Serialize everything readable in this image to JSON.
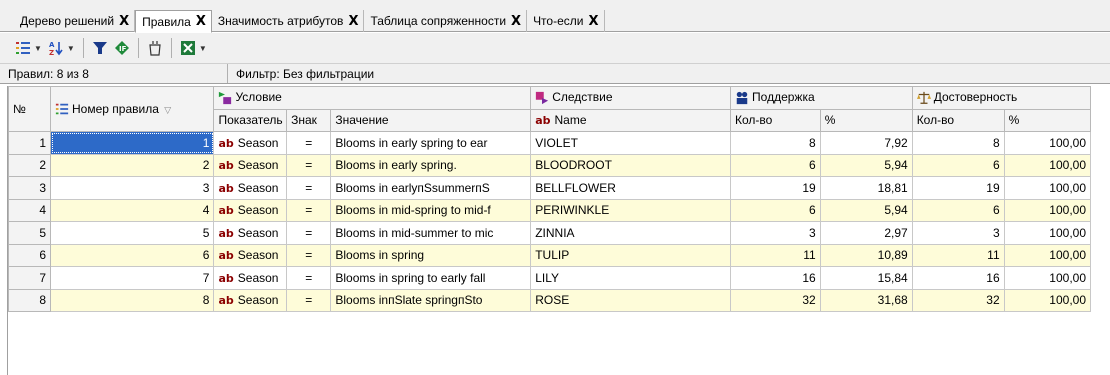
{
  "tabs": [
    {
      "label": "Дерево решений"
    },
    {
      "label": "Правила"
    },
    {
      "label": "Значимость атрибутов"
    },
    {
      "label": "Таблица сопряженности"
    },
    {
      "label": "Что-если"
    }
  ],
  "active_tab": 1,
  "close_glyph": "X",
  "status": {
    "rules_count": "Правил: 8 из 8",
    "filter": "Фильтр: Без фильтрации"
  },
  "table": {
    "headers": {
      "no": "№",
      "rule_number": "Номер правила",
      "condition": "Условие",
      "consequence": "Следствие",
      "support": "Поддержка",
      "confidence": "Достоверность",
      "indicator": "Показатель",
      "sign": "Знак",
      "value": "Значение",
      "name": "Name",
      "count": "Кол-во",
      "percent": "%"
    },
    "ab_label": "ab",
    "rows": [
      {
        "no": "1",
        "rule": "1",
        "indicator": "Season",
        "sign": "=",
        "value": "Blooms in early spring to ear",
        "name": "VIOLET",
        "support_count": "8",
        "support_pct": "7,92",
        "conf_count": "8",
        "conf_pct": "100,00"
      },
      {
        "no": "2",
        "rule": "2",
        "indicator": "Season",
        "sign": "=",
        "value": "Blooms in early spring.",
        "name": "BLOODROOT",
        "support_count": "6",
        "support_pct": "5,94",
        "conf_count": "6",
        "conf_pct": "100,00"
      },
      {
        "no": "3",
        "rule": "3",
        "indicator": "Season",
        "sign": "=",
        "value": "Blooms in earlyпSsummerпS",
        "name": "BELLFLOWER",
        "support_count": "19",
        "support_pct": "18,81",
        "conf_count": "19",
        "conf_pct": "100,00"
      },
      {
        "no": "4",
        "rule": "4",
        "indicator": "Season",
        "sign": "=",
        "value": "Blooms in mid-spring to mid-f",
        "name": "PERIWINKLE",
        "support_count": "6",
        "support_pct": "5,94",
        "conf_count": "6",
        "conf_pct": "100,00"
      },
      {
        "no": "5",
        "rule": "5",
        "indicator": "Season",
        "sign": "=",
        "value": "Blooms in mid-summer to mic",
        "name": "ZINNIA",
        "support_count": "3",
        "support_pct": "2,97",
        "conf_count": "3",
        "conf_pct": "100,00"
      },
      {
        "no": "6",
        "rule": "6",
        "indicator": "Season",
        "sign": "=",
        "value": "Blooms in spring",
        "name": "TULIP",
        "support_count": "11",
        "support_pct": "10,89",
        "conf_count": "11",
        "conf_pct": "100,00"
      },
      {
        "no": "7",
        "rule": "7",
        "indicator": "Season",
        "sign": "=",
        "value": "Blooms in spring to early fall",
        "name": "LILY",
        "support_count": "16",
        "support_pct": "15,84",
        "conf_count": "16",
        "conf_pct": "100,00"
      },
      {
        "no": "8",
        "rule": "8",
        "indicator": "Season",
        "sign": "=",
        "value": "Blooms inпSlate springпSto",
        "name": "ROSE",
        "support_count": "32",
        "support_pct": "31,68",
        "conf_count": "32",
        "conf_pct": "100,00"
      }
    ]
  },
  "colors": {
    "row_highlight": "#fefcd9",
    "selection": "#2d6ac8",
    "ab_text": "#8b0000"
  }
}
